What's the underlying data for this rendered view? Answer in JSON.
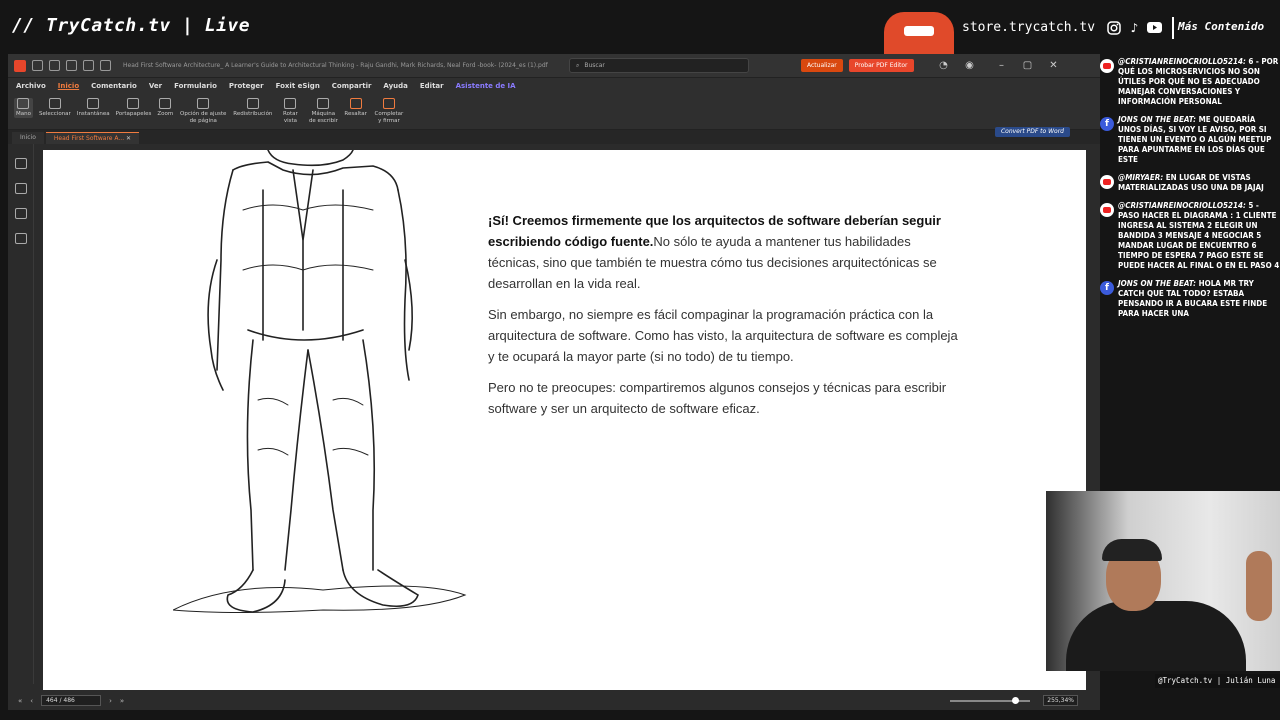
{
  "stream": {
    "title": "// TryCatch.tv | Live",
    "store": "store.trycatch.tv",
    "more": "Más Contenido",
    "caption": "@TryCatch.tv | Julián Luna"
  },
  "app": {
    "filename": "Head First Software Architecture_ A Learner's Guide to Architectural Thinking - Raju Gandhi, Mark Richards, Neal Ford -book- (2024_es (1).pdf",
    "search_placeholder": "Buscar",
    "update_label": "Actualizar",
    "try_label": "Probar PDF Editor",
    "menu": [
      "Archivo",
      "Inicio",
      "Comentario",
      "Ver",
      "Formulario",
      "Proteger",
      "Foxit eSign",
      "Compartir",
      "Ayuda",
      "Editar",
      "Asistente de IA"
    ],
    "ribbon": [
      {
        "label": "Mano"
      },
      {
        "label": "Seleccionar"
      },
      {
        "label": "Instantánea"
      },
      {
        "label": "Portapapeles"
      },
      {
        "label": "Zoom"
      },
      {
        "label": "Opción de ajuste de página"
      },
      {
        "label": "Redistribución"
      },
      {
        "label": "Rotar vista"
      },
      {
        "label": "Máquina de escribir"
      },
      {
        "label": "Resaltar"
      },
      {
        "label": "Completar y firmar"
      }
    ],
    "tabs": [
      "Inicio",
      "Head First Software A..."
    ],
    "convert": "Convert PDF to Word",
    "page_indicator": "464 / 486",
    "zoom": "255,34%"
  },
  "document": {
    "p1_bold": "¡Sí! Creemos firmemente que los arquitectos de software deberían seguir escribiendo código fuente.",
    "p1_rest": "No sólo te ayuda a mantener tus habilidades técnicas, sino que también te muestra cómo tus decisiones arquitectónicas se desarrollan en la vida real.",
    "p2": "Sin embargo, no siempre es fácil compaginar la programación práctica con la arquitectura de software. Como has visto, la arquitectura de software es compleja y te ocupará la mayor parte (si no todo) de tu tiempo.",
    "p3": "Pero no te preocupes: compartiremos algunos consejos y técnicas para escribir software y ser un arquitecto de software eficaz."
  },
  "chat": [
    {
      "platform": "yt",
      "user": "@CRISTIANREINOCRIOLLO5214:",
      "text": "6 - POR QUÉ LOS MICROSERVICIOS NO SON ÚTILES POR QUÉ NO ES ADECUADO MANEJAR CONVERSACIONES Y INFORMACIÓN PERSONAL"
    },
    {
      "platform": "fb",
      "user": "JONS ON THE BEAT:",
      "text": "ME QUEDARÍA UNOS DÍAS, SI VOY LE AVISO, POR SI TIENEN UN EVENTO O ALGÚN MEETUP PARA APUNTARME EN LOS DÍAS QUE ESTE"
    },
    {
      "platform": "yt",
      "user": "@MIRYAER:",
      "text": "EN LUGAR DE VISTAS MATERIALIZADAS USO UNA DB JAJAJ"
    },
    {
      "platform": "yt",
      "user": "@CRISTIANREINOCRIOLLO5214:",
      "text": "5 - PASO HACER EL DIAGRAMA : 1 CLIENTE INGRESA AL SISTEMA 2 ELEGIR UN BANDIDA 3 MENSAJE 4 NEGOCIAR 5 MANDAR LUGAR DE ENCUENTRO 6 TIEMPO DE ESPERA 7 PAGO ESTE SE PUEDE HACER AL FINAL O EN EL PASO 4"
    },
    {
      "platform": "fb",
      "user": "JONS ON THE BEAT:",
      "text": "HOLA MR TRY CATCH QUE TAL TODO? ESTABA PENSANDO IR A BUCARA ESTE FINDE PARA HACER UNA"
    }
  ]
}
